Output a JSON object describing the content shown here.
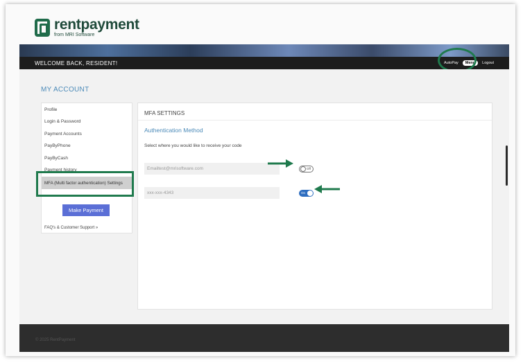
{
  "brand": {
    "name": "rentpayment",
    "sub": "from MRI Software",
    "color": "#1f6b4a"
  },
  "topbar": {
    "welcome": "WELCOME BACK, RESIDENT!",
    "autopay": "AutoPay",
    "menu": "Menu",
    "logout": "Logout"
  },
  "account": {
    "title": "MY ACCOUNT"
  },
  "sidebar": {
    "items": [
      {
        "label": "Profile"
      },
      {
        "label": "Login & Password"
      },
      {
        "label": "Payment Accounts"
      },
      {
        "label": "PayByPhone"
      },
      {
        "label": "PayByCash"
      },
      {
        "label": "Payment history"
      },
      {
        "label": "MFA (Multi factor authentication) Settings",
        "active": true
      }
    ],
    "make_payment": "Make Payment",
    "faq": "FAQ's & Customer Support »"
  },
  "mfa": {
    "title": "MFA SETTINGS",
    "method_title": "Authentication Method",
    "instructions": "Select where you would like to receive your code",
    "email": {
      "value": "Emailtest@mrisoftware.com",
      "toggle_label": "Off",
      "enabled": false
    },
    "phone": {
      "value": "xxx-xxx-4343",
      "toggle_label": "On",
      "enabled": true
    }
  },
  "footer": {
    "copyright": "© 2025 RentPayment"
  },
  "colors": {
    "accent": "#4b8ab8",
    "button": "#5b6fd6",
    "toggle_on": "#2d6dc0",
    "highlight": "#1f7a4d"
  },
  "icons": {
    "annotation_arrow": "arrow-icon"
  }
}
